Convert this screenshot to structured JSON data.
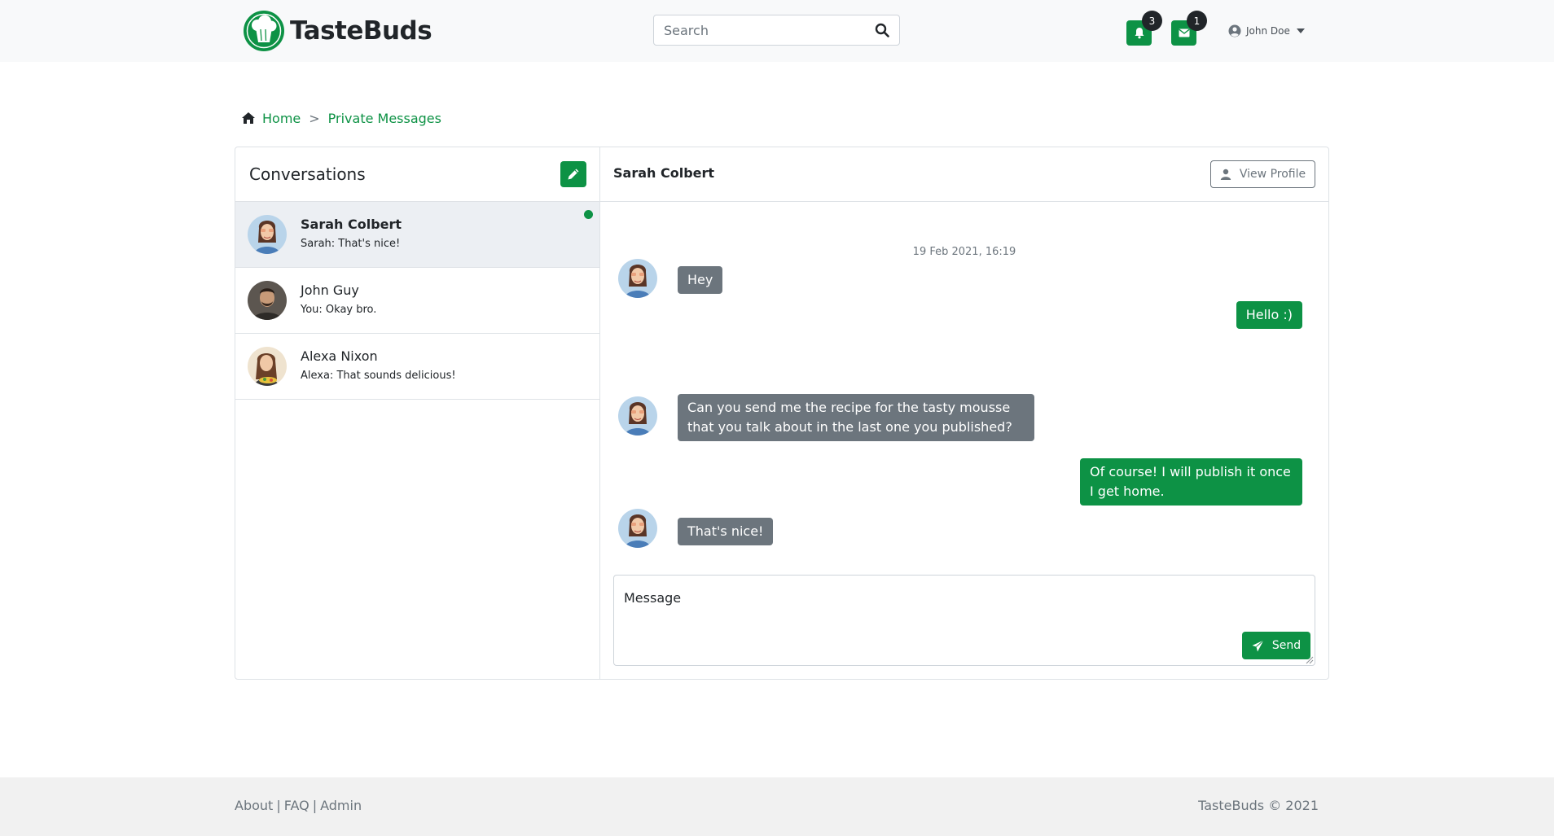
{
  "brand": {
    "name": "TasteBuds",
    "accent_color": "#0d9245"
  },
  "navbar": {
    "search": {
      "placeholder": "Search",
      "icon": "search-icon"
    },
    "notifications": {
      "icon": "bell-icon",
      "count": "3"
    },
    "messages": {
      "icon": "envelope-icon",
      "count": "1"
    },
    "user": {
      "icon": "user-circle-icon",
      "name": "John Doe"
    }
  },
  "breadcrumb": {
    "home_icon": "home-icon",
    "items": [
      "Home",
      "Private Messages"
    ],
    "separator": ">"
  },
  "conversations": {
    "title": "Conversations",
    "compose_icon": "pencil-icon",
    "items": [
      {
        "name": "Sarah Colbert",
        "preview": "Sarah: That's nice!",
        "active": true,
        "online": true
      },
      {
        "name": "John Guy",
        "preview": "You: Okay bro."
      },
      {
        "name": "Alexa Nixon",
        "preview": "Alexa: That sounds delicious!"
      }
    ]
  },
  "chat": {
    "contact_name": "Sarah Colbert",
    "view_profile_label": "View Profile",
    "timestamp": "19 Feb 2021, 16:19",
    "messages": [
      {
        "from": "them",
        "text": "Hey"
      },
      {
        "from": "me",
        "text": "Hello :)"
      },
      {
        "from": "them",
        "text": "Can you send me the recipe for the tasty mousse that you talk about in the last one you published?"
      },
      {
        "from": "me",
        "text": "Of course! I will publish it once I get home."
      },
      {
        "from": "them",
        "text": "That's nice!"
      }
    ],
    "input_placeholder": "Message",
    "send_label": "Send",
    "send_icon": "paper-plane-icon"
  },
  "footer": {
    "links": [
      "About",
      "FAQ",
      "Admin"
    ],
    "separator": "|",
    "copyright": "TasteBuds © 2021"
  }
}
